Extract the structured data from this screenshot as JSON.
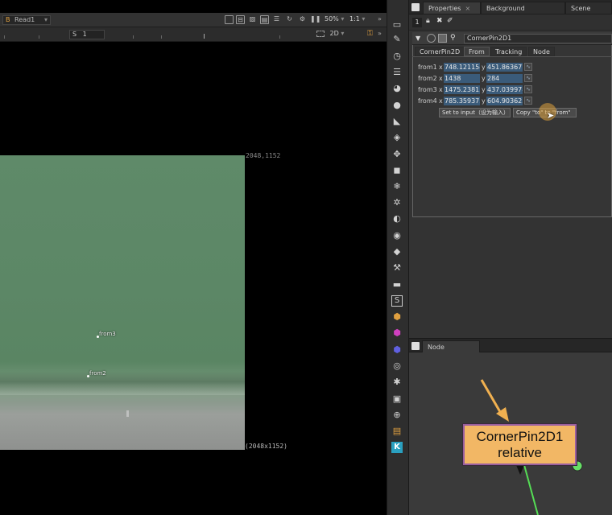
{
  "viewer": {
    "read_node": "Read1",
    "read_prefix": "B",
    "zoom": "50%",
    "ratio": "1:1",
    "frame_prefix": "S",
    "frame_value": "1",
    "view_mode": "2D",
    "res_top": "2048,1152",
    "res_bottom": "(2048x1152)",
    "pins": {
      "from3": "from3",
      "from2": "from2"
    }
  },
  "props": {
    "tabs": [
      {
        "label": "Properties",
        "close": "×"
      },
      {
        "label": "Background Renders",
        "close": "×"
      },
      {
        "label": "Scene Graph",
        "close": ""
      }
    ],
    "panel_count": "1",
    "node_name": "CornerPin2D1",
    "knob_tabs": [
      "CornerPin2D",
      "From",
      "Tracking",
      "Node"
    ],
    "rows": [
      {
        "label": "from1",
        "x": "748.121154",
        "y": "451.863677"
      },
      {
        "label": "from2",
        "x": "1438",
        "y": "284"
      },
      {
        "label": "from3",
        "x": "1475.23815",
        "y": "437.039978"
      },
      {
        "label": "from4",
        "x": "785.359375",
        "y": "604.903625"
      }
    ],
    "axis_x": "x",
    "axis_y": "y",
    "btn_set_input": "Set to input（设为输入）",
    "btn_copy": "Copy \"to\" to \"from\""
  },
  "graph": {
    "tab_label": "Node Graph",
    "tab_close": "×",
    "node_line1": "CornerPin2D1",
    "node_line2": "relative"
  },
  "colors": {
    "node_fill": "#f2b765",
    "node_border": "#9a5f9f",
    "field_blue": "#3a5b7a",
    "arrow_orange": "#f0b050",
    "link_green": "#55dd55"
  }
}
